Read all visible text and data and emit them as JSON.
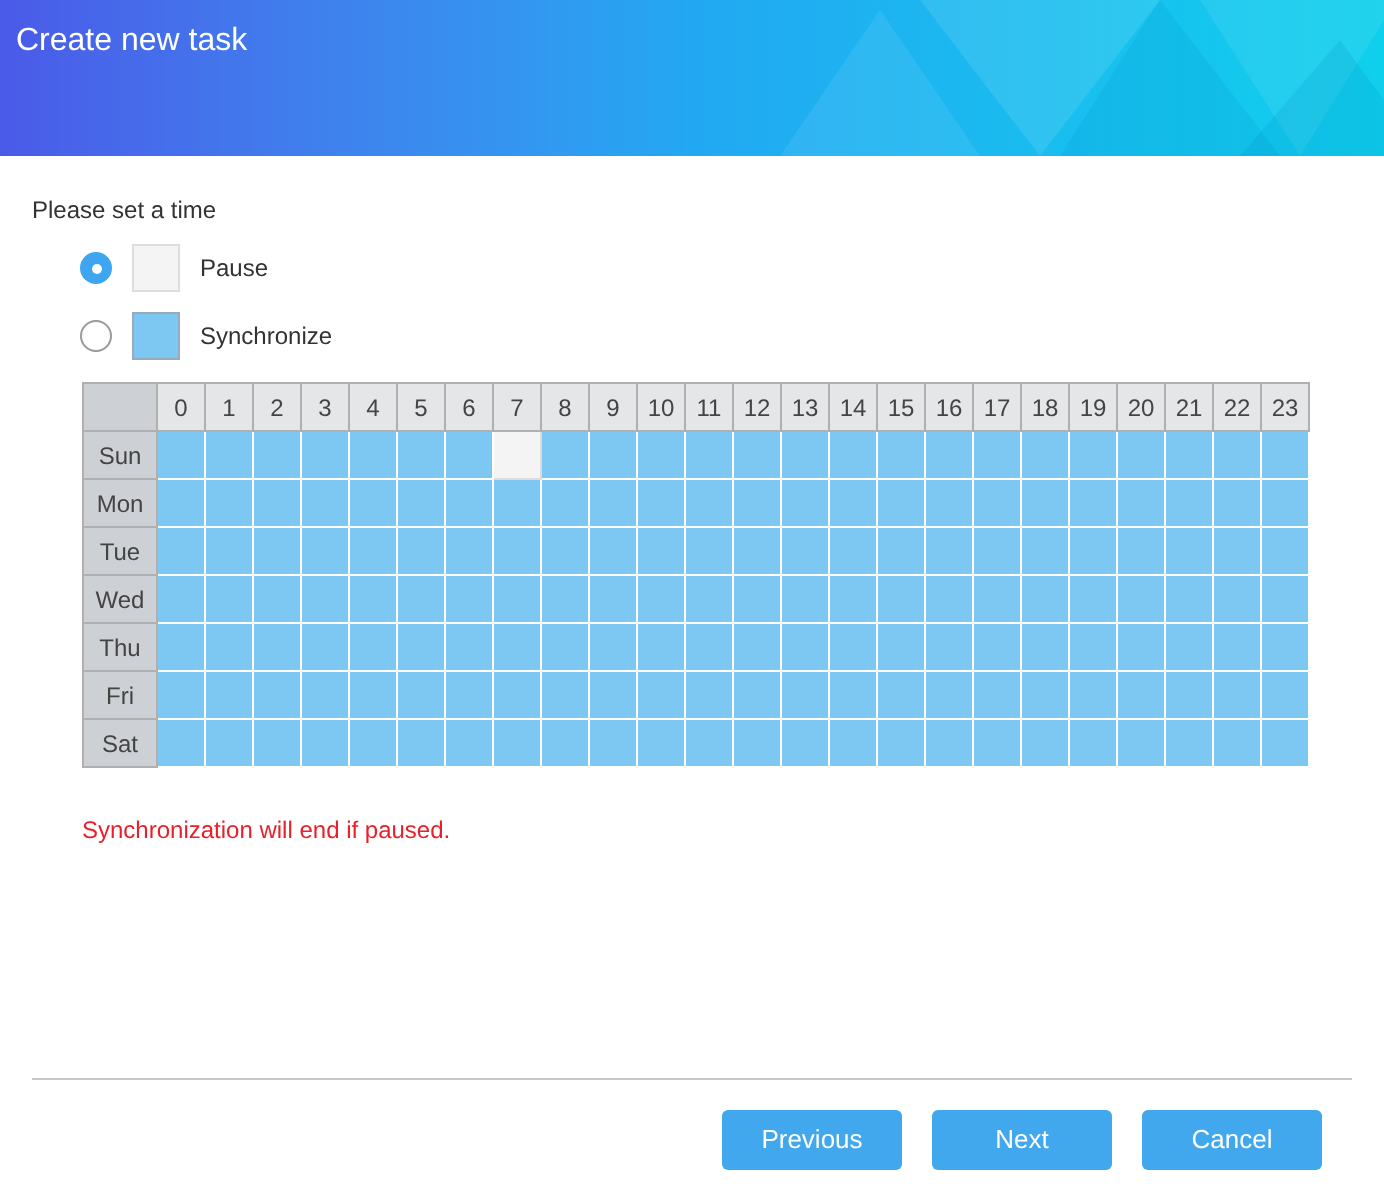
{
  "window": {
    "title": "Create new task"
  },
  "prompt": "Please set a time",
  "options": [
    {
      "kind": "pause",
      "label": "Pause",
      "selected": true
    },
    {
      "kind": "sync",
      "label": "Synchronize",
      "selected": false
    }
  ],
  "schedule": {
    "hours": [
      "0",
      "1",
      "2",
      "3",
      "4",
      "5",
      "6",
      "7",
      "8",
      "9",
      "10",
      "11",
      "12",
      "13",
      "14",
      "15",
      "16",
      "17",
      "18",
      "19",
      "20",
      "21",
      "22",
      "23"
    ],
    "days": [
      {
        "label": "Sun",
        "paused": [
          false,
          false,
          false,
          false,
          false,
          false,
          false,
          true,
          false,
          false,
          false,
          false,
          false,
          false,
          false,
          false,
          false,
          false,
          false,
          false,
          false,
          false,
          false,
          false
        ]
      },
      {
        "label": "Mon",
        "paused": [
          false,
          false,
          false,
          false,
          false,
          false,
          false,
          false,
          false,
          false,
          false,
          false,
          false,
          false,
          false,
          false,
          false,
          false,
          false,
          false,
          false,
          false,
          false,
          false
        ]
      },
      {
        "label": "Tue",
        "paused": [
          false,
          false,
          false,
          false,
          false,
          false,
          false,
          false,
          false,
          false,
          false,
          false,
          false,
          false,
          false,
          false,
          false,
          false,
          false,
          false,
          false,
          false,
          false,
          false
        ]
      },
      {
        "label": "Wed",
        "paused": [
          false,
          false,
          false,
          false,
          false,
          false,
          false,
          false,
          false,
          false,
          false,
          false,
          false,
          false,
          false,
          false,
          false,
          false,
          false,
          false,
          false,
          false,
          false,
          false
        ]
      },
      {
        "label": "Thu",
        "paused": [
          false,
          false,
          false,
          false,
          false,
          false,
          false,
          false,
          false,
          false,
          false,
          false,
          false,
          false,
          false,
          false,
          false,
          false,
          false,
          false,
          false,
          false,
          false,
          false
        ]
      },
      {
        "label": "Fri",
        "paused": [
          false,
          false,
          false,
          false,
          false,
          false,
          false,
          false,
          false,
          false,
          false,
          false,
          false,
          false,
          false,
          false,
          false,
          false,
          false,
          false,
          false,
          false,
          false,
          false
        ]
      },
      {
        "label": "Sat",
        "paused": [
          false,
          false,
          false,
          false,
          false,
          false,
          false,
          false,
          false,
          false,
          false,
          false,
          false,
          false,
          false,
          false,
          false,
          false,
          false,
          false,
          false,
          false,
          false,
          false
        ]
      }
    ]
  },
  "warning": "Synchronization will end if paused.",
  "buttons": [
    "Previous",
    "Next",
    "Cancel"
  ]
}
